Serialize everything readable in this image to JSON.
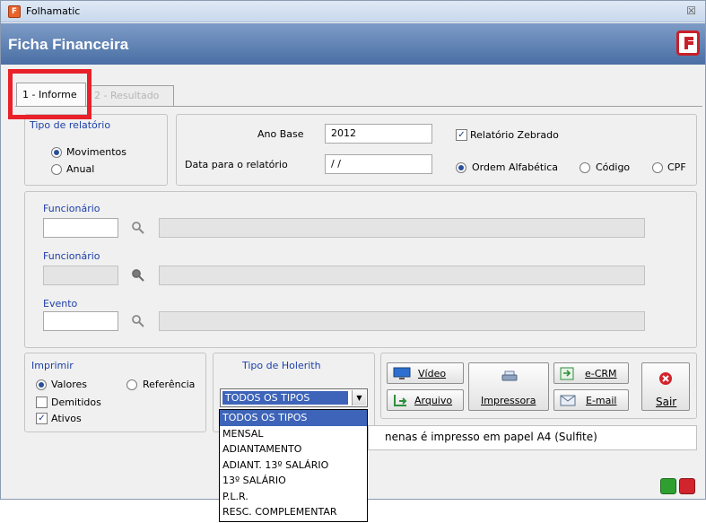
{
  "window": {
    "title": "Folhamatic",
    "close_glyph": "☒"
  },
  "header": {
    "title": "Ficha Financeira"
  },
  "tabs": [
    {
      "label": "1 - Informe",
      "active": true
    },
    {
      "label": "2 - Resultado",
      "active": false
    }
  ],
  "tipo_relatorio": {
    "title": "Tipo de relatório",
    "options": [
      {
        "label": "Movimentos",
        "selected": true
      },
      {
        "label": "Anual",
        "selected": false
      }
    ]
  },
  "params": {
    "ano_base_label": "Ano Base",
    "ano_base_value": "2012",
    "data_label": "Data para o relatório",
    "data_value": " / /",
    "zebrado_label": "Relatório Zebrado",
    "zebrado_checked": true,
    "ordem": [
      {
        "label": "Ordem Alfabética",
        "selected": true
      },
      {
        "label": "Código",
        "selected": false
      },
      {
        "label": "CPF",
        "selected": false
      }
    ]
  },
  "filtros": {
    "funcionario1_label": "Funcionário",
    "funcionario2_label": "Funcionário",
    "evento_label": "Evento"
  },
  "imprimir": {
    "title": "Imprimir",
    "valores_label": "Valores",
    "referencia_label": "Referência",
    "demitidos_label": "Demitidos",
    "ativos_label": "Ativos",
    "valores_selected": true,
    "demitidos_checked": false,
    "ativos_checked": true
  },
  "holerith": {
    "title": "Tipo de Holerith",
    "selected": "TODOS OS TIPOS",
    "options": [
      "TODOS OS TIPOS",
      "MENSAL",
      "ADIANTAMENTO",
      "ADIANT. 13º SALÁRIO",
      "13º SALÁRIO",
      "P.L.R.",
      "RESC. COMPLEMENTAR"
    ]
  },
  "buttons": {
    "video": "Vídeo",
    "arquivo": "Arquivo",
    "impressora": "Impressora",
    "ecrm": "e-CRM",
    "email": "E-mail",
    "sair": "Sair"
  },
  "message": "nenas é impresso em papel A4 (Sulfite)",
  "colors": {
    "header_blue": "#4a6fa5",
    "accent_red": "#e8212a",
    "label_blue": "#1c3fa8"
  }
}
